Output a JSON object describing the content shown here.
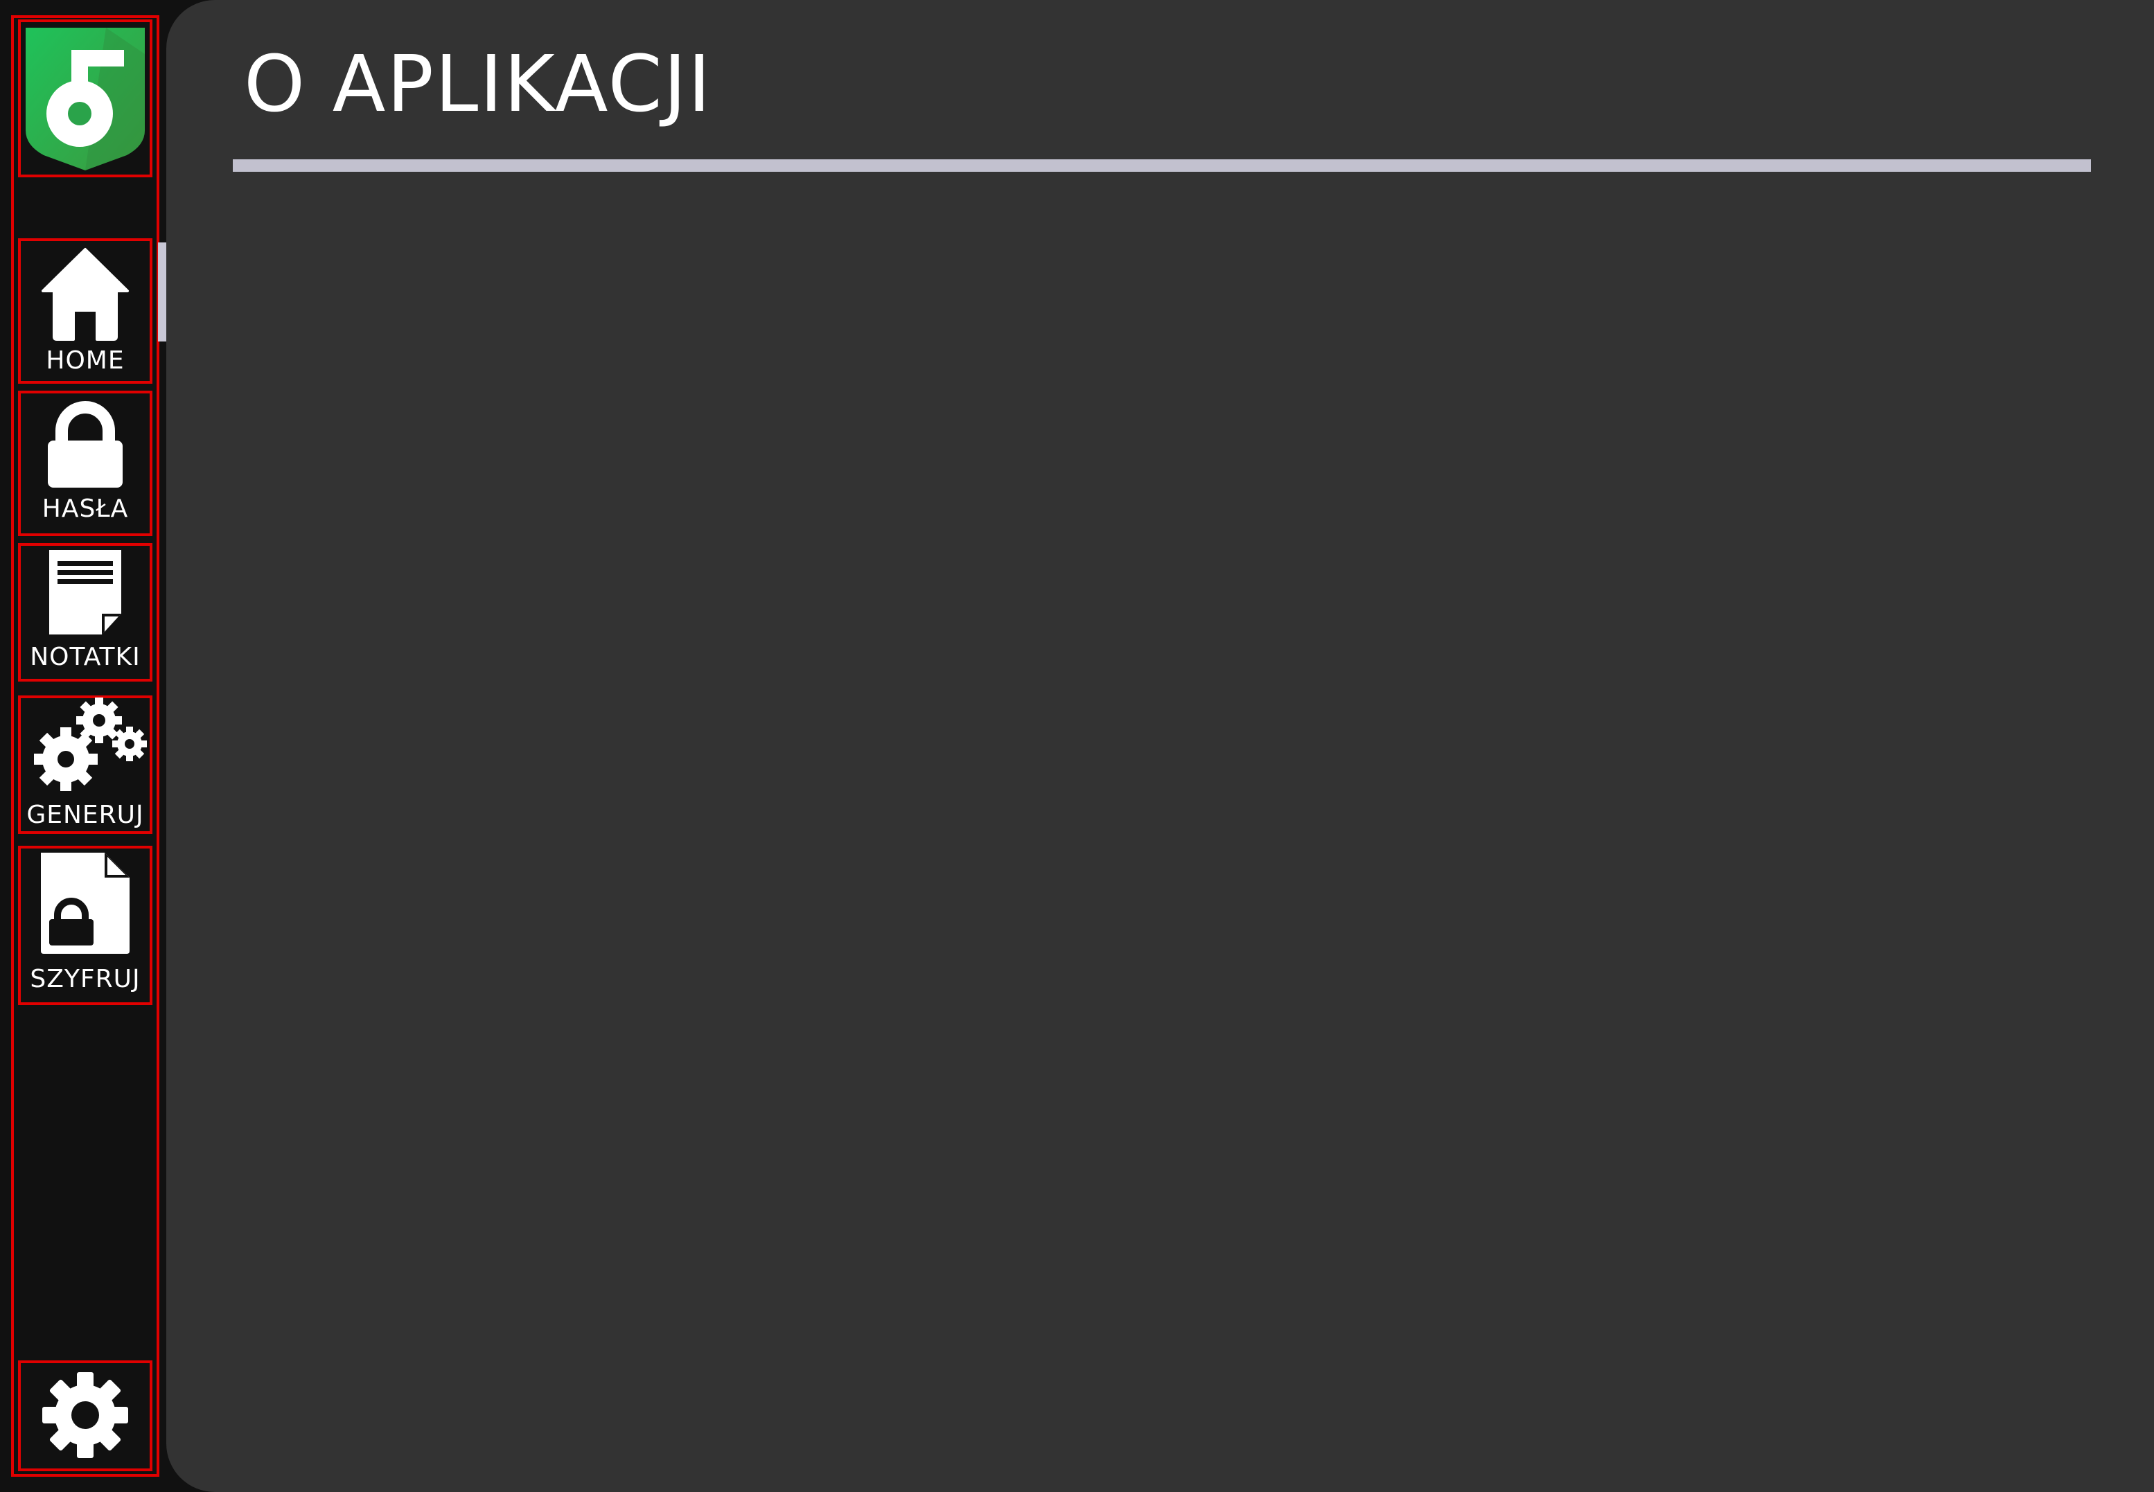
{
  "page": {
    "title": "O APLIKACJI"
  },
  "sidebar": {
    "logo_icon": "key-shield-icon",
    "items": [
      {
        "label": "HOME",
        "icon": "home-icon"
      },
      {
        "label": "HASŁA",
        "icon": "lock-icon"
      },
      {
        "label": "NOTATKI",
        "icon": "note-icon"
      },
      {
        "label": "GENERUJ",
        "icon": "gears-icon"
      },
      {
        "label": "SZYFRUJ",
        "icon": "encrypted-file-icon"
      }
    ],
    "settings_icon": "gear-icon"
  },
  "colors": {
    "sidebar_bg": "#111111",
    "main_bg": "#333333",
    "accent_green": "#2bb24c",
    "divider": "#c2c1cf",
    "outline": "#e00000"
  }
}
